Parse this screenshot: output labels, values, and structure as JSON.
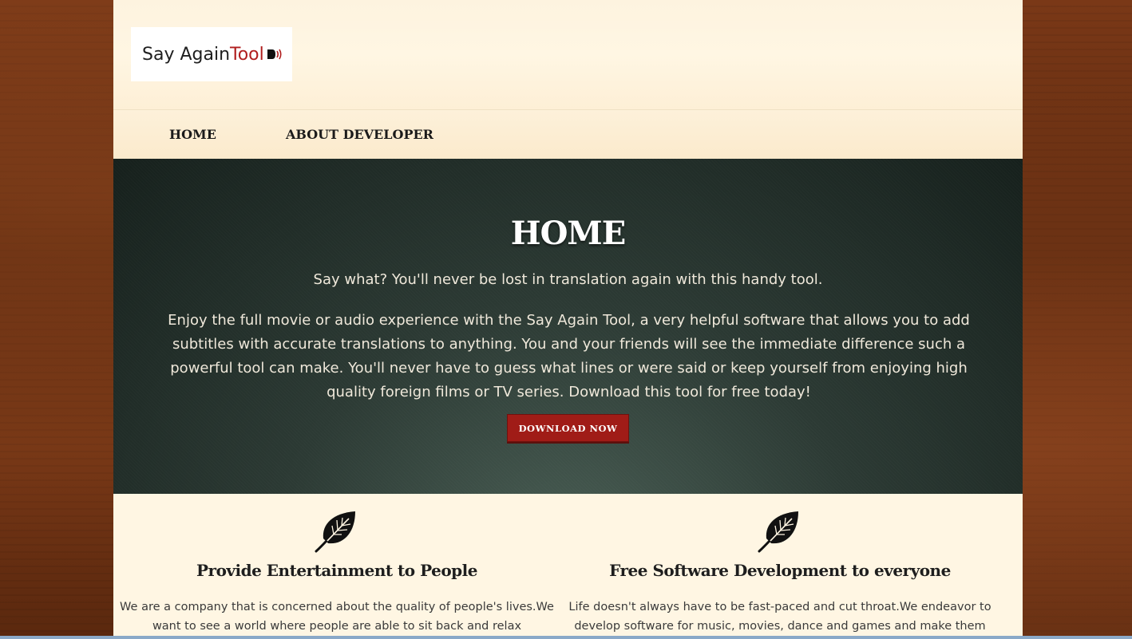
{
  "logo": {
    "text_main": "Say Again ",
    "text_accent": "Tool",
    "icon": "speaker-sound-icon"
  },
  "nav": {
    "items": [
      {
        "label": "HOME"
      },
      {
        "label": "ABOUT DEVELOPER"
      }
    ]
  },
  "hero": {
    "title": "HOME",
    "tagline": "Say what? You'll never be lost in translation again with this handy tool.",
    "description": "Enjoy the full movie or audio experience with the Say Again Tool, a very helpful software that allows you to add subtitles with accurate translations to anything. You and your friends will see the immediate difference such a powerful tool can make. You'll never have to guess what lines or were said or keep yourself from enjoying high quality foreign films or TV series. Download this tool for free today!",
    "button_label": "DOWNLOAD NOW"
  },
  "features": [
    {
      "icon": "leaf-icon",
      "title": "Provide Entertainment to People",
      "text": "We are a company that is concerned about the quality of people's lives.We want to see a world where people are able to sit back and relax"
    },
    {
      "icon": "leaf-icon",
      "title": "Free Software Development to everyone",
      "text": "Life doesn't always have to be fast-paced and cut throat.We endeavor to develop software for music, movies, dance and games and make them"
    }
  ],
  "colors": {
    "accent": "#a01c17",
    "hero_bg": "#2c3a34",
    "header_bg": "#fdf3df",
    "wood": "#6b2f12"
  }
}
